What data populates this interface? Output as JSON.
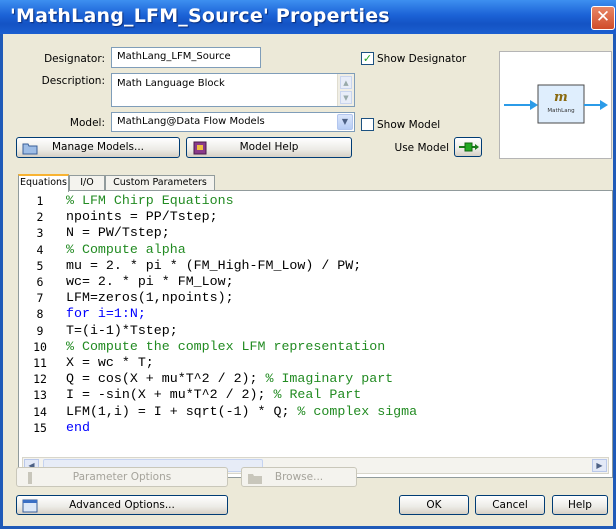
{
  "window": {
    "title": "'MathLang_LFM_Source' Properties",
    "close_glyph": "✕"
  },
  "form": {
    "designator_label": "Designator:",
    "designator_value": "MathLang_LFM_Source",
    "description_label": "Description:",
    "description_value": "Math Language Block",
    "model_label": "Model:",
    "model_value": "MathLang@Data Flow Models",
    "show_designator_label": "Show Designator",
    "show_designator_checked": true,
    "show_model_label": "Show Model",
    "show_model_checked": false,
    "use_model_label": "Use Model"
  },
  "buttons": {
    "manage_models": "Manage Models...",
    "model_help": "Model Help",
    "parameter_options": "Parameter Options",
    "browse": "Browse...",
    "advanced_options": "Advanced Options...",
    "ok": "OK",
    "cancel": "Cancel",
    "help": "Help"
  },
  "preview": {
    "block_glyph": "m",
    "block_label": "MathLang"
  },
  "tabs": [
    {
      "label": "Equations",
      "active": true
    },
    {
      "label": "I/O",
      "active": false
    },
    {
      "label": "Custom Parameters",
      "active": false
    }
  ],
  "code_lines": [
    {
      "num": "1",
      "text": "% LFM Chirp Equations",
      "kind": "comment"
    },
    {
      "num": "2",
      "text": "npoints = PP/Tstep;",
      "kind": "code"
    },
    {
      "num": "3",
      "text": "N = PW/Tstep;",
      "kind": "code"
    },
    {
      "num": "4",
      "text": "% Compute alpha",
      "kind": "comment"
    },
    {
      "num": "5",
      "text": "mu = 2. * pi * (FM_High-FM_Low) / PW;",
      "kind": "code"
    },
    {
      "num": "6",
      "text": "wc= 2. * pi * FM_Low;",
      "kind": "code"
    },
    {
      "num": "7",
      "text": "LFM=zeros(1,npoints);",
      "kind": "code"
    },
    {
      "num": "8",
      "text": "for i=1:N;",
      "kind": "keyword"
    },
    {
      "num": "9",
      "text": "T=(i-1)*Tstep;",
      "kind": "code"
    },
    {
      "num": "10",
      "text": "% Compute the complex LFM representation",
      "kind": "comment"
    },
    {
      "num": "11",
      "text": "X = wc * T;",
      "kind": "code"
    },
    {
      "num": "12",
      "text": "Q = cos(X + mu*T^2 / 2);",
      "comment": " % Imaginary part",
      "kind": "mixed"
    },
    {
      "num": "13",
      "text": "I = -sin(X + mu*T^2 / 2);",
      "comment": " % Real Part",
      "kind": "mixed"
    },
    {
      "num": "14",
      "text": "LFM(1,i) = I + sqrt(-1) * Q;",
      "comment": " % complex sigma",
      "kind": "mixed"
    },
    {
      "num": "15",
      "text": "end",
      "kind": "keyword"
    }
  ],
  "icons": {
    "close": "close-icon",
    "manage_models": "folder-icon",
    "model_help": "help-book-icon",
    "use_model": "use-model-icon",
    "parameter_options": "options-icon",
    "browse": "folder-open-icon",
    "advanced_options": "window-icon"
  },
  "colors": {
    "titlebar": "#1f5ab8",
    "dialog_bg": "#ece9d8",
    "comment": "#228b22",
    "keyword": "#0000ff",
    "preview_arrow": "#2b9be8"
  }
}
